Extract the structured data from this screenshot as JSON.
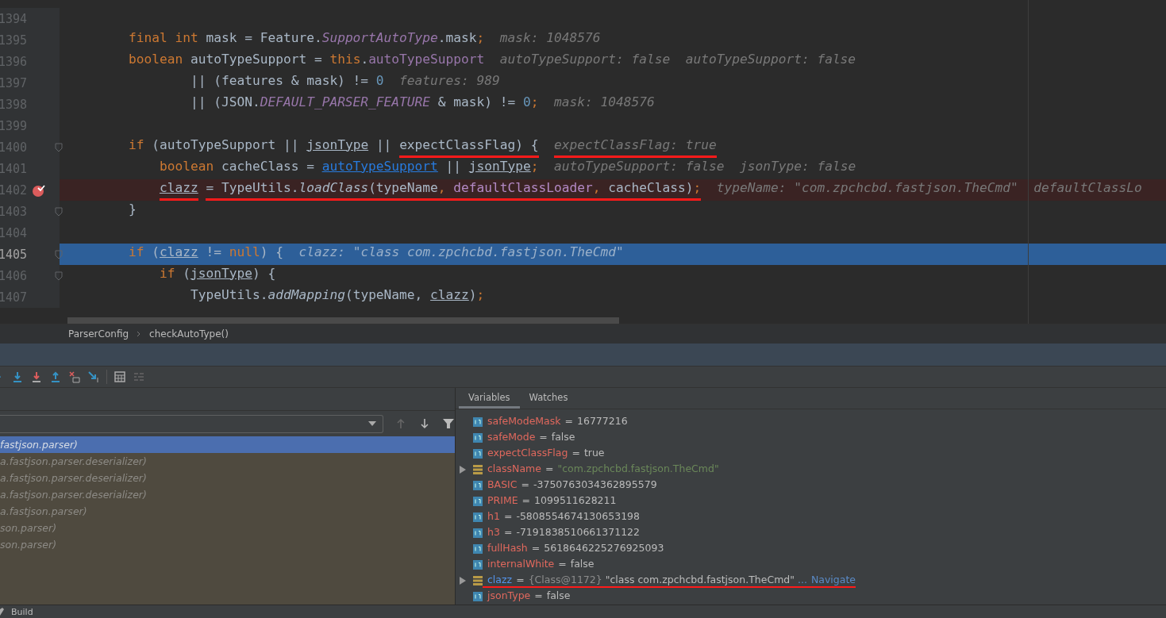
{
  "editor": {
    "lines": [
      {
        "number": "1394"
      },
      {
        "number": "1395",
        "tokens": [
          {
            "kind": "kw",
            "text": "    final int "
          },
          {
            "kind": "plain",
            "text": "mask = Feature."
          },
          {
            "kind": "static",
            "text": "SupportAutoType"
          },
          {
            "kind": "plain",
            "text": ".mask"
          },
          {
            "kind": "kw",
            "text": ";"
          },
          {
            "kind": "hint",
            "text": "  mask: 1048576"
          }
        ]
      },
      {
        "number": "1396",
        "tokens": [
          {
            "kind": "kw",
            "text": "    boolean "
          },
          {
            "kind": "plain",
            "text": "autoTypeSupport = "
          },
          {
            "kind": "kw",
            "text": "this"
          },
          {
            "kind": "plain",
            "text": "."
          },
          {
            "kind": "field",
            "text": "autoTypeSupport"
          },
          {
            "kind": "hint",
            "text": "  autoTypeSupport: false  autoTypeSupport: false"
          }
        ]
      },
      {
        "number": "1397",
        "tokens": [
          {
            "kind": "plain",
            "text": "            || (features & mask) != "
          },
          {
            "kind": "num",
            "text": "0"
          },
          {
            "kind": "hint",
            "text": "  features: 989"
          }
        ]
      },
      {
        "number": "1398",
        "tokens": [
          {
            "kind": "plain",
            "text": "            || (JSON."
          },
          {
            "kind": "static",
            "text": "DEFAULT_PARSER_FEATURE"
          },
          {
            "kind": "plain",
            "text": " & mask) != "
          },
          {
            "kind": "num",
            "text": "0"
          },
          {
            "kind": "kw",
            "text": ";"
          },
          {
            "kind": "hint",
            "text": "  mask: 1048576"
          }
        ]
      },
      {
        "number": "1399"
      },
      {
        "number": "1400",
        "fold": true,
        "tokens": [
          {
            "kind": "kw",
            "text": "    if "
          },
          {
            "kind": "plain",
            "text": "(autoTypeSupport || "
          },
          {
            "kind": "local",
            "text": "jsonType"
          },
          {
            "kind": "plain",
            "text": " || "
          },
          {
            "kind": "plain",
            "text": "expectClassFlag) {",
            "marked": true
          },
          {
            "kind": "hint",
            "text": "  expectClassFlag: true",
            "marked": true
          }
        ]
      },
      {
        "number": "1401",
        "tokens": [
          {
            "kind": "kw",
            "text": "        boolean "
          },
          {
            "kind": "plain",
            "text": "cacheClass = "
          },
          {
            "kind": "link",
            "text": "autoTypeSupport"
          },
          {
            "kind": "plain",
            "text": " || "
          },
          {
            "kind": "local",
            "text": "jsonType"
          },
          {
            "kind": "kw",
            "text": ";"
          },
          {
            "kind": "hint",
            "text": "  autoTypeSupport: false  jsonType: false"
          }
        ]
      },
      {
        "number": "1402",
        "breakpoint": true,
        "tokens": [
          {
            "kind": "local",
            "text": "        clazz",
            "marked": true
          },
          {
            "kind": "plain",
            "text": " = TypeUtils.",
            "marked": true
          },
          {
            "kind": "method",
            "text": "loadClass",
            "marked": true
          },
          {
            "kind": "plain",
            "text": "(typeName",
            "marked": true
          },
          {
            "kind": "kw",
            "text": ", ",
            "marked": true
          },
          {
            "kind": "param",
            "text": "defaultClassLoader",
            "marked": true
          },
          {
            "kind": "kw",
            "text": ", ",
            "marked": true
          },
          {
            "kind": "plain",
            "text": "cacheClass)",
            "marked": true
          },
          {
            "kind": "kw",
            "text": ";",
            "marked": true
          },
          {
            "kind": "hint",
            "text": "  typeName: \"com.zpchcbd.fastjson.TheCmd\"  defaultClassLo"
          }
        ]
      },
      {
        "number": "1403",
        "fold": true,
        "tokens": [
          {
            "kind": "plain",
            "text": "    }"
          }
        ]
      },
      {
        "number": "1404"
      },
      {
        "number": "1405",
        "fold": true,
        "current": true,
        "tokens": [
          {
            "kind": "kw",
            "text": "    if "
          },
          {
            "kind": "plain",
            "text": "("
          },
          {
            "kind": "local",
            "text": "clazz"
          },
          {
            "kind": "plain",
            "text": " != "
          },
          {
            "kind": "kw",
            "text": "null"
          },
          {
            "kind": "plain",
            "text": ") {"
          },
          {
            "kind": "hint",
            "text": "  clazz: \"class com.zpchcbd.fastjson.TheCmd\""
          }
        ]
      },
      {
        "number": "1406",
        "fold": true,
        "tokens": [
          {
            "kind": "kw",
            "text": "        if "
          },
          {
            "kind": "plain",
            "text": "("
          },
          {
            "kind": "local",
            "text": "jsonType"
          },
          {
            "kind": "plain",
            "text": ") {"
          }
        ]
      },
      {
        "number": "1407",
        "tokens": [
          {
            "kind": "plain",
            "text": "            TypeUtils."
          },
          {
            "kind": "method",
            "text": "addMapping"
          },
          {
            "kind": "plain",
            "text": "(typeName, "
          },
          {
            "kind": "local",
            "text": "clazz"
          },
          {
            "kind": "plain",
            "text": ")"
          },
          {
            "kind": "kw",
            "text": ";"
          }
        ]
      }
    ]
  },
  "breadcrumb": [
    "ParserConfig",
    "checkAutoType()"
  ],
  "frames": [
    {
      "text": "fastjson.parser)",
      "selected": true
    },
    {
      "text": "a.fastjson.parser.deserializer)",
      "selected": false
    },
    {
      "text": "a.fastjson.parser.deserializer)",
      "selected": false
    },
    {
      "text": "a.fastjson.parser.deserializer)",
      "selected": false
    },
    {
      "text": "a.fastjson.parser)",
      "selected": false
    },
    {
      "text": "son.parser)",
      "selected": false
    },
    {
      "text": "son.parser)",
      "selected": false
    }
  ],
  "debug_tabs": [
    {
      "label": "Variables",
      "selected": true
    },
    {
      "label": "Watches",
      "selected": false
    }
  ],
  "variables": [
    {
      "kind": "primitive",
      "name": "safeModeMask",
      "sign": "=",
      "value": "16777216"
    },
    {
      "kind": "primitive",
      "name": "safeMode",
      "sign": "=",
      "value": "false"
    },
    {
      "kind": "primitive",
      "name": "expectClassFlag",
      "sign": "=",
      "value": "true"
    },
    {
      "kind": "object",
      "name": "className",
      "sign": "=",
      "string_value": "\"com.zpchcbd.fastjson.TheCmd\""
    },
    {
      "kind": "primitive",
      "name": "BASIC",
      "sign": "=",
      "value": "-3750763034362895579"
    },
    {
      "kind": "primitive",
      "name": "PRIME",
      "sign": "=",
      "value": "1099511628211"
    },
    {
      "kind": "primitive",
      "name": "h1",
      "sign": "=",
      "value": "-5808554674130653198"
    },
    {
      "kind": "primitive",
      "name": "h3",
      "sign": "=",
      "value": "-7191838510661371122"
    },
    {
      "kind": "primitive",
      "name": "fullHash",
      "sign": "=",
      "value": "5618646225276925093"
    },
    {
      "kind": "primitive",
      "name": "internalWhite",
      "sign": "=",
      "value": "false"
    },
    {
      "kind": "object",
      "name": "clazz",
      "sign": "=",
      "changed": true,
      "marked": true,
      "type": "{Class@1172}",
      "value": "\"class com.zpchcbd.fastjson.TheCmd\"",
      "more": "...",
      "link": "Navigate"
    },
    {
      "kind": "primitive",
      "name": "jsonType",
      "sign": "=",
      "value": "false"
    }
  ],
  "status_bar": {
    "tab": "Build"
  }
}
